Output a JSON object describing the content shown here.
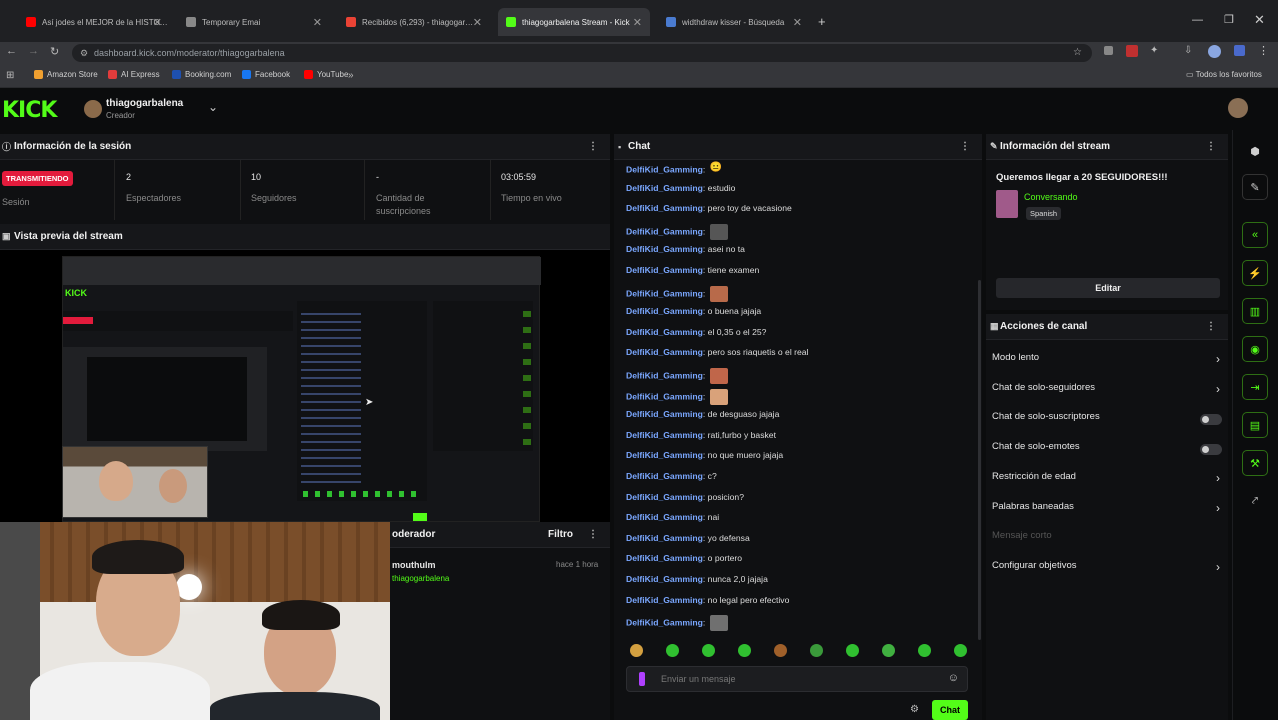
{
  "browser": {
    "tabs": [
      {
        "label": "Así jodes el MEJOR de la HISTO…",
        "fav": "#ff0000"
      },
      {
        "label": "Temporary Emai",
        "fav": "#888888"
      },
      {
        "label": "Recibidos (6,293) - thiagogar…",
        "fav": "#ea4335"
      },
      {
        "label": "thiagogarbalena Stream - Kick",
        "fav": "#53fc18"
      },
      {
        "label": "widthdraw kisser - Búsqueda",
        "fav": "#4a7bd0"
      }
    ],
    "new_tab": "+",
    "url": "dashboard.kick.com/moderator/thiagogarbalena",
    "bookmarks": [
      {
        "label": "Amazon Store",
        "color": "#f0a030"
      },
      {
        "label": "AI Express",
        "color": "#e23c3c"
      },
      {
        "label": "Booking.com",
        "color": "#1e50b0"
      },
      {
        "label": "Facebook",
        "color": "#1877f2"
      },
      {
        "label": "YouTube",
        "color": "#ff0000"
      }
    ],
    "all_bookmarks": "Todos los favoritos"
  },
  "header": {
    "logo": "KICK",
    "channel_name": "thiagogarbalena",
    "role": "Creador"
  },
  "session": {
    "title": "Información de la sesión",
    "live_badge": "TRANSMITIENDO",
    "session_label": "Sesión",
    "stats": [
      {
        "value": "2",
        "label": "Espectadores"
      },
      {
        "value": "10",
        "label": "Seguidores"
      },
      {
        "value": "-",
        "label": "Cantidad de suscripciones"
      },
      {
        "value": "03:05:59",
        "label": "Tiempo en vivo"
      }
    ]
  },
  "preview": {
    "title": "Vista previa del stream"
  },
  "moderator_panel": {
    "title": "oderador",
    "filter_label": "Filtro",
    "entry_user": "mouthulm",
    "entry_channel": "thiagogarbalena",
    "entry_time": "hace 1 hora"
  },
  "chat": {
    "title": "Chat",
    "messages": [
      {
        "user": "DelfiKid_Gamming",
        "text": "",
        "emote": "#6f6656",
        "emote_text": "😐"
      },
      {
        "user": "DelfiKid_Gamming",
        "text": "estudio",
        "emote": ""
      },
      {
        "user": "DelfiKid_Gamming",
        "text": "pero toy de vacasione",
        "emote": ""
      },
      {
        "user": "DelfiKid_Gamming",
        "text": "",
        "emote": "#565656"
      },
      {
        "user": "DelfiKid_Gamming",
        "text": "asei no ta",
        "emote": ""
      },
      {
        "user": "DelfiKid_Gamming",
        "text": "tiene examen",
        "emote": ""
      },
      {
        "user": "DelfiKid_Gamming",
        "text": "",
        "emote": "#b86a4a"
      },
      {
        "user": "DelfiKid_Gamming",
        "text": "o buena jajaja",
        "emote": ""
      },
      {
        "user": "DelfiKid_Gamming",
        "text": "el 0,35 o el 25?",
        "emote": ""
      },
      {
        "user": "DelfiKid_Gamming",
        "text": "pero sos riaquetis o el real",
        "emote": ""
      },
      {
        "user": "DelfiKid_Gamming",
        "text": "",
        "emote": "#c0664a"
      },
      {
        "user": "DelfiKid_Gamming",
        "text": "",
        "emote": "#d9a27a"
      },
      {
        "user": "DelfiKid_Gamming",
        "text": "de desguaso jajaja",
        "emote": ""
      },
      {
        "user": "DelfiKid_Gamming",
        "text": "rati,furbo y basket",
        "emote": ""
      },
      {
        "user": "DelfiKid_Gamming",
        "text": "no que muero jajaja",
        "emote": ""
      },
      {
        "user": "DelfiKid_Gamming",
        "text": "c?",
        "emote": ""
      },
      {
        "user": "DelfiKid_Gamming",
        "text": "posicion?",
        "emote": ""
      },
      {
        "user": "DelfiKid_Gamming",
        "text": "nai",
        "emote": ""
      },
      {
        "user": "DelfiKid_Gamming",
        "text": "yo defensa",
        "emote": ""
      },
      {
        "user": "DelfiKid_Gamming",
        "text": "o portero",
        "emote": ""
      },
      {
        "user": "DelfiKid_Gamming",
        "text": "nunca 2,0 jajaja",
        "emote": ""
      },
      {
        "user": "DelfiKid_Gamming",
        "text": "no legal pero efectivo",
        "emote": ""
      },
      {
        "user": "DelfiKid_Gamming",
        "text": "",
        "emote": "#707070"
      }
    ],
    "input_placeholder": "Enviar un mensaje",
    "send_label": "Chat",
    "emote_colors": [
      "#d4a040",
      "#30c030",
      "#30c030",
      "#30c030",
      "#a0602a",
      "#3a9a3a",
      "#30c030",
      "#40b040",
      "#30c030",
      "#30c030"
    ]
  },
  "stream_info": {
    "title": "Información del stream",
    "stream_title": "Queremos llegar a 20 SEGUIDORES!!!",
    "category": "Conversando",
    "tag": "Spanish",
    "edit_label": "Editar"
  },
  "channel_actions": {
    "title": "Acciones de canal",
    "items": [
      {
        "label": "Modo lento",
        "control": "chevron"
      },
      {
        "label": "Chat de solo-seguidores",
        "control": "chevron"
      },
      {
        "label": "Chat de solo-suscriptores",
        "control": "toggle"
      },
      {
        "label": "Chat de solo-emotes",
        "control": "toggle"
      },
      {
        "label": "Restricción de edad",
        "control": "chevron"
      },
      {
        "label": "Palabras baneadas",
        "control": "chevron"
      },
      {
        "label": "Mensaje corto",
        "control": "none"
      },
      {
        "label": "Configurar objetivos",
        "control": "chevron"
      }
    ]
  },
  "colors": {
    "accent": "#53fc18",
    "live": "#e31b3c",
    "username": "#7aa7ff"
  }
}
